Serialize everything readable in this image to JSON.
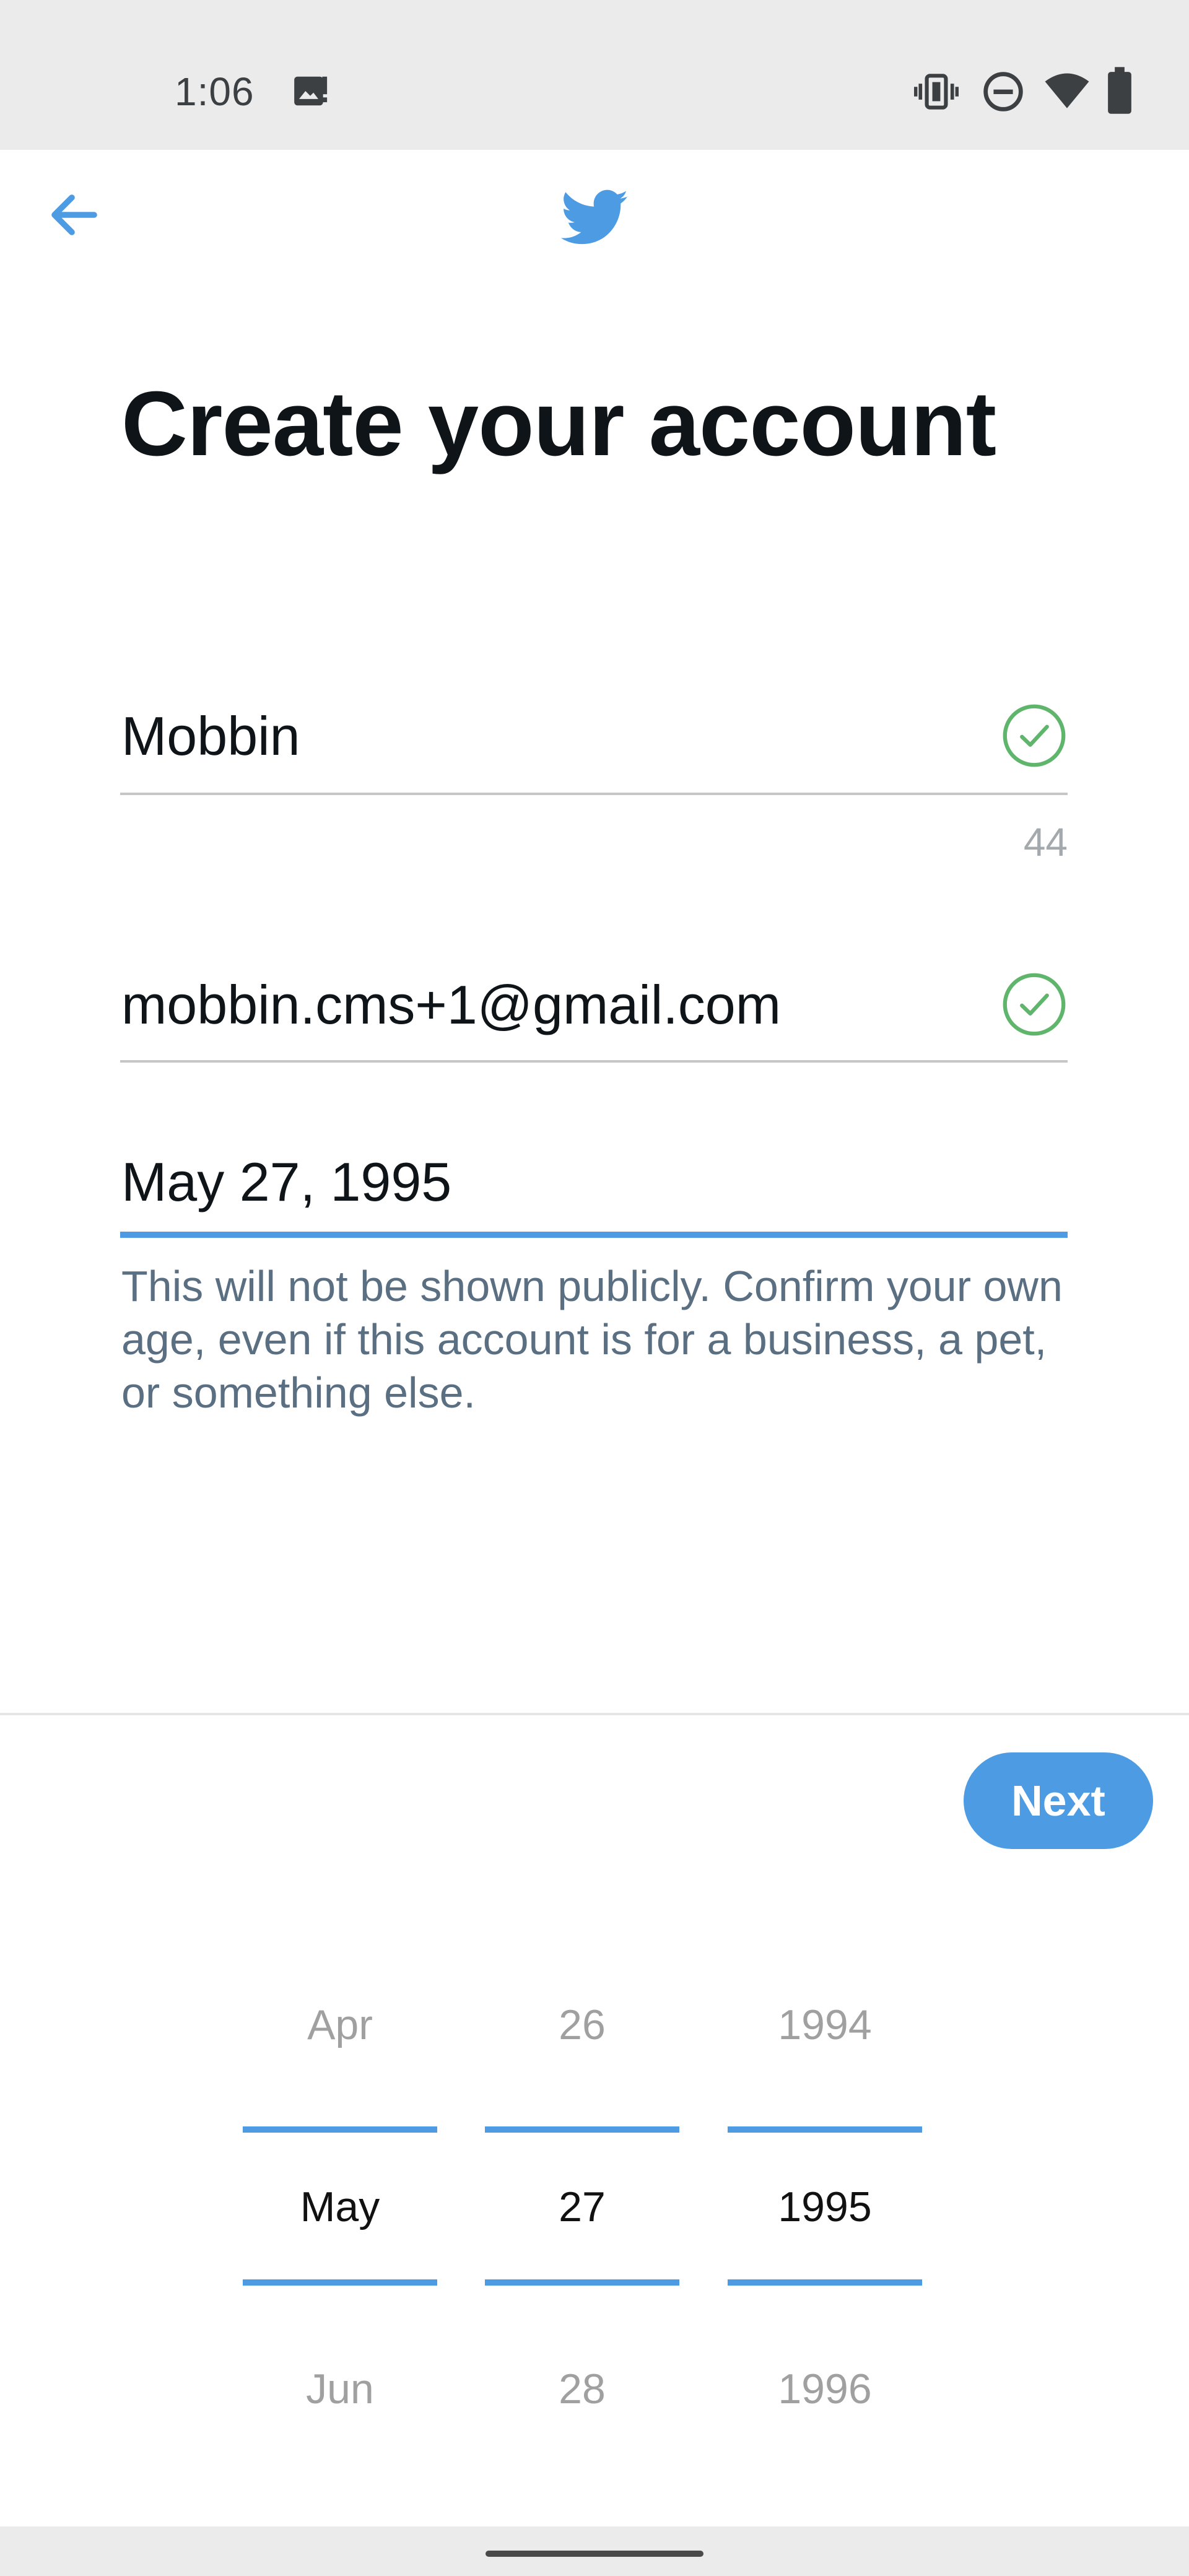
{
  "status_bar": {
    "time": "1:06",
    "icons": [
      "image-notification-icon",
      "vibrate-icon",
      "do-not-disturb-icon",
      "wifi-icon",
      "battery-icon"
    ]
  },
  "app_bar": {
    "back_icon": "arrow-left-icon",
    "logo_icon": "twitter-bird-icon"
  },
  "page": {
    "title": "Create your account"
  },
  "form": {
    "name": {
      "value": "Mobbin",
      "char_count": "44",
      "valid": true
    },
    "email": {
      "value": "mobbin.cms+1@gmail.com",
      "valid": true
    },
    "birthdate": {
      "value": "May 27, 1995"
    },
    "helper_text": "This will not be shown publicly. Confirm your own age, even if this account is for a business, a pet, or something else."
  },
  "actions": {
    "next_label": "Next"
  },
  "date_picker": {
    "month": {
      "prev": "Apr",
      "current": "May",
      "next": "Jun"
    },
    "day": {
      "prev": "26",
      "current": "27",
      "next": "28"
    },
    "year": {
      "prev": "1994",
      "current": "1995",
      "next": "1996"
    }
  },
  "colors": {
    "accent": "#4c9be3",
    "valid": "#5fb56b",
    "helper_text": "#5b6f82"
  }
}
